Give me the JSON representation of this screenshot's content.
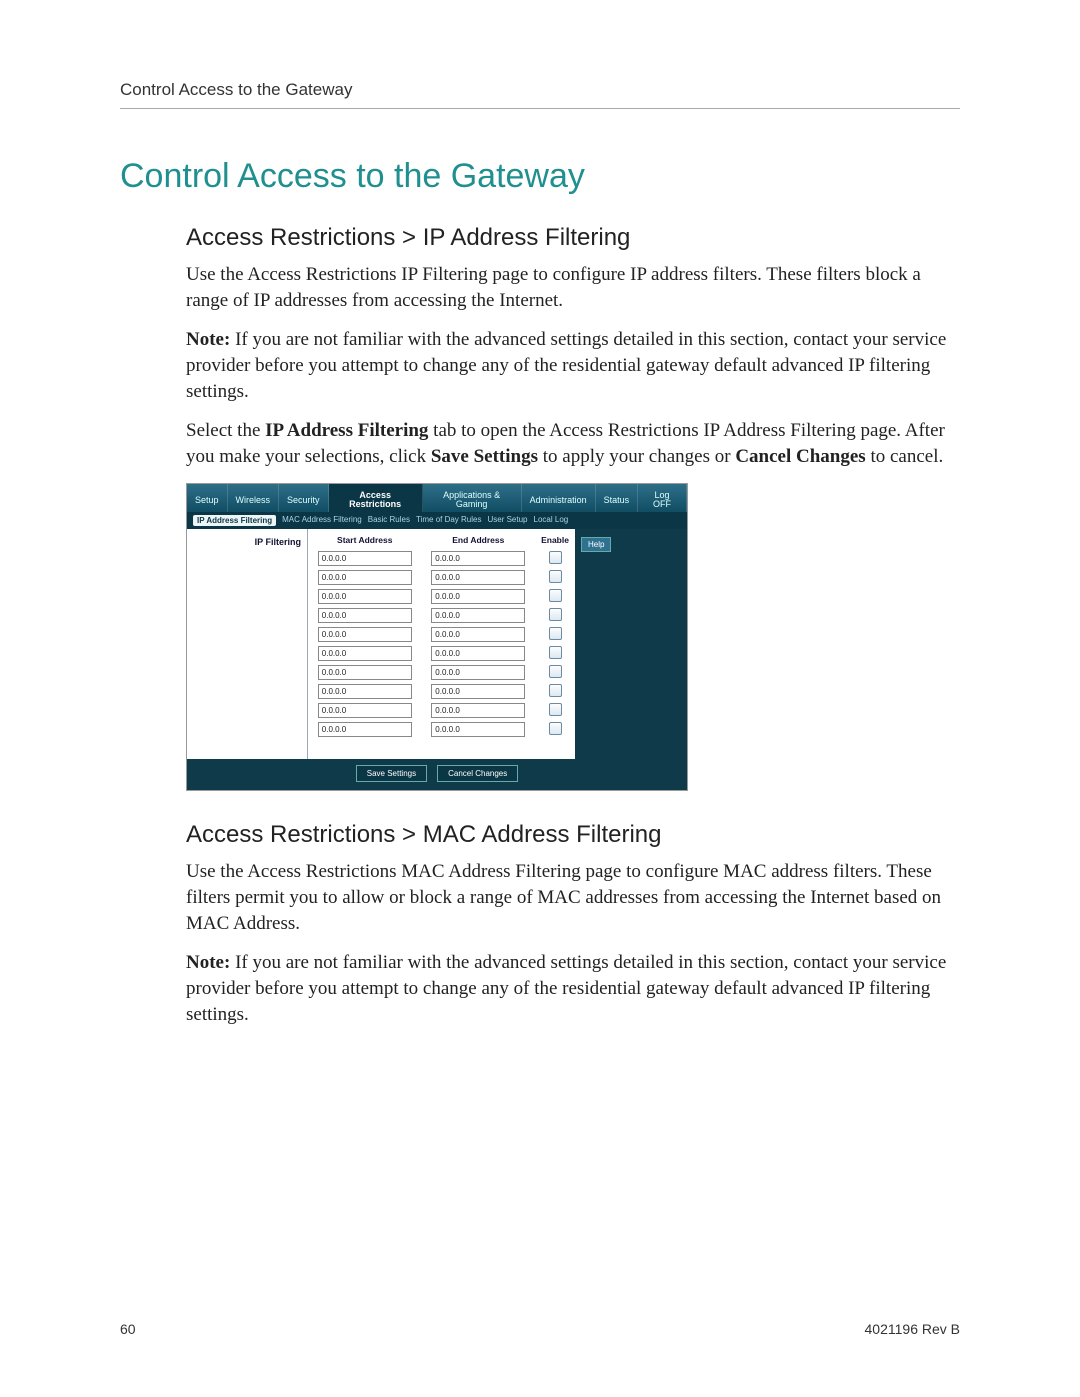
{
  "running_head": "Control Access to the Gateway",
  "title": "Control Access to the Gateway",
  "section1": {
    "heading": "Access Restrictions > IP Address Filtering",
    "p1": "Use the Access Restrictions IP Filtering page to configure IP address filters. These filters block a range of IP addresses from accessing the Internet.",
    "p2_prefix": "Note:",
    "p2_rest": " If you are not familiar with the advanced settings detailed in this section, contact your service provider before you attempt to change any of the residential gateway default advanced IP filtering settings.",
    "p3_a": "Select the ",
    "p3_b": "IP Address Filtering",
    "p3_c": " tab to open the Access Restrictions IP Address Filtering page. After you make your selections, click ",
    "p3_d": "Save Settings",
    "p3_e": " to apply your changes or ",
    "p3_f": "Cancel Changes",
    "p3_g": " to cancel."
  },
  "section2": {
    "heading": "Access Restrictions > MAC Address Filtering",
    "p1": "Use the Access Restrictions MAC Address Filtering page to configure MAC address filters. These filters permit you to allow or block a range of MAC addresses from accessing the Internet based on MAC Address.",
    "p2_prefix": "Note:",
    "p2_rest": " If you are not familiar with the advanced settings detailed in this section, contact your service provider before you attempt to change any of the residential gateway default advanced IP filtering settings."
  },
  "footer": {
    "page": "60",
    "docid": "4021196 Rev B"
  },
  "router_ui": {
    "topnav": [
      "Setup",
      "Wireless",
      "Security",
      "Access Restrictions",
      "Applications & Gaming",
      "Administration",
      "Status",
      "Log OFF"
    ],
    "topnav_active_index": 3,
    "subnav": [
      "IP Address Filtering",
      "MAC Address Filtering",
      "Basic Rules",
      "Time of Day Rules",
      "User Setup",
      "Local Log"
    ],
    "subnav_active_index": 0,
    "sidebar_label": "IP Filtering",
    "columns": [
      "Start Address",
      "End Address",
      "Enable"
    ],
    "rows": [
      {
        "start": "0.0.0.0",
        "end": "0.0.0.0",
        "enable": false
      },
      {
        "start": "0.0.0.0",
        "end": "0.0.0.0",
        "enable": false
      },
      {
        "start": "0.0.0.0",
        "end": "0.0.0.0",
        "enable": false
      },
      {
        "start": "0.0.0.0",
        "end": "0.0.0.0",
        "enable": false
      },
      {
        "start": "0.0.0.0",
        "end": "0.0.0.0",
        "enable": false
      },
      {
        "start": "0.0.0.0",
        "end": "0.0.0.0",
        "enable": false
      },
      {
        "start": "0.0.0.0",
        "end": "0.0.0.0",
        "enable": false
      },
      {
        "start": "0.0.0.0",
        "end": "0.0.0.0",
        "enable": false
      },
      {
        "start": "0.0.0.0",
        "end": "0.0.0.0",
        "enable": false
      },
      {
        "start": "0.0.0.0",
        "end": "0.0.0.0",
        "enable": false
      }
    ],
    "help_label": "Help",
    "save_label": "Save Settings",
    "cancel_label": "Cancel Changes"
  }
}
